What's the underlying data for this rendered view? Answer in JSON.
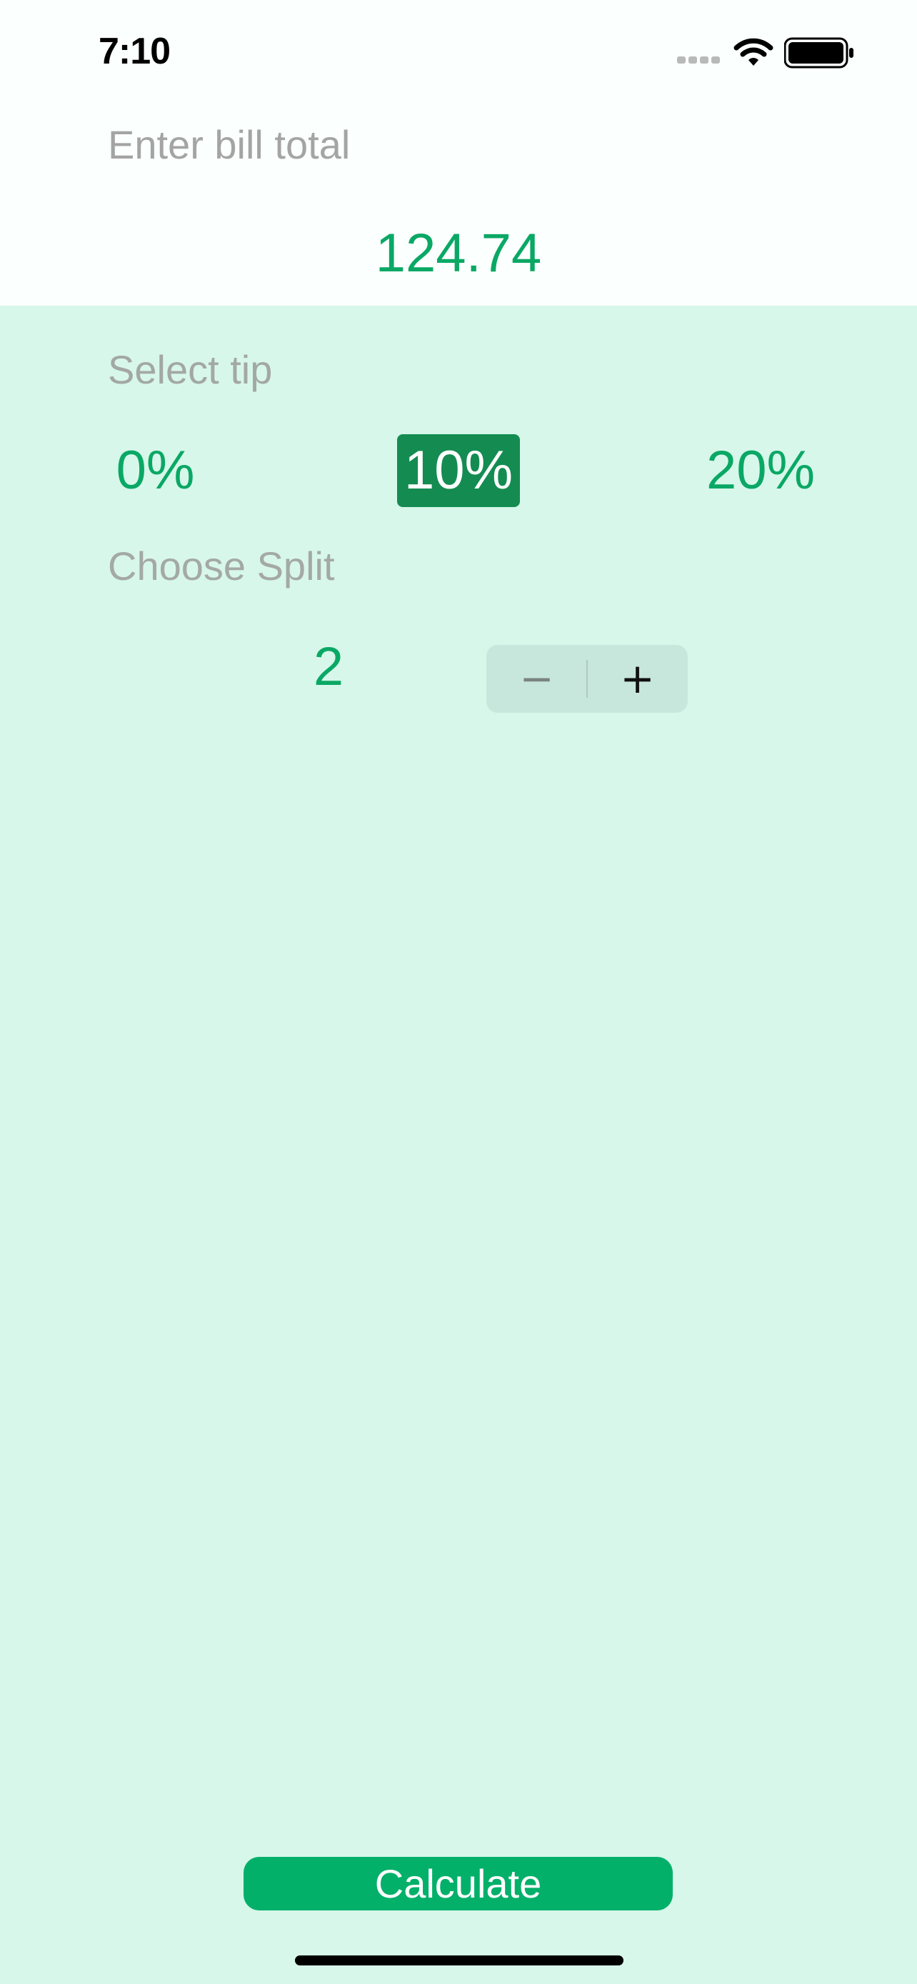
{
  "status_bar": {
    "time": "7:10",
    "icons": [
      "cellular-signal-icon",
      "wifi-icon",
      "battery-icon"
    ]
  },
  "bill": {
    "label": "Enter bill total",
    "value": "124.74"
  },
  "tip": {
    "label": "Select tip",
    "options": [
      "0%",
      "10%",
      "20%"
    ],
    "selected": "10%"
  },
  "split": {
    "label": "Choose Split",
    "value": "2"
  },
  "stepper": {
    "minus": "−",
    "plus": "+"
  },
  "calculate": {
    "label": "Calculate"
  },
  "colors": {
    "background": "#d7f7ea",
    "header_background": "#fbfffe",
    "accent": "#0aa865",
    "selected_tip": "#148c51",
    "button": "#03b06a",
    "label": "#a4a4a4"
  }
}
